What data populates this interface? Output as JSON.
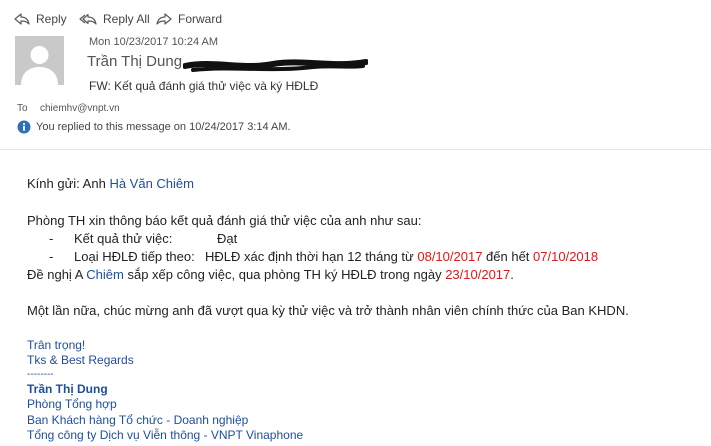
{
  "toolbar": {
    "reply_label": "Reply",
    "reply_all_label": "Reply All",
    "forward_label": "Forward"
  },
  "header": {
    "date": "Mon 10/23/2017 10:24 AM",
    "sender_name": "Trần Thị Dung",
    "subject": "FW:  Kết quả đánh giá thử việc và ký HĐLĐ",
    "to_label": "To",
    "to_value": "chiemhv@vnpt.vn",
    "info_text": "You replied to this message on 10/24/2017 3:14 AM."
  },
  "body": {
    "greeting_prefix": "Kính gửi: Anh ",
    "greeting_name": "Hà Văn Chiêm",
    "intro": "Phòng TH xin thông báo kết quả đánh giá thử việc của anh như sau:",
    "item1_dash": "-",
    "item1_label": "Kết quả thử việc:",
    "item1_value": "Đạt",
    "item2_dash": "-",
    "item2_label": "Loại HĐLĐ tiếp theo:",
    "item2_value": "HĐLĐ xác định thời hạn 12 tháng từ ",
    "item2_from": "08/10/2017",
    "item2_mid": " đến hết ",
    "item2_to": "07/10/2018",
    "request_prefix": "Đề nghị A ",
    "request_name": "Chiêm",
    "request_mid": " sắp xếp công việc, qua phòng TH ký HĐLĐ trong ngày ",
    "request_date": "23/10/2017",
    "request_end": ".",
    "congrats": "Một lần nữa, chúc mừng anh đã vượt qua kỳ thử việc và trở thành nhân viên chính thức của Ban KHDN."
  },
  "signature": {
    "line1": "Trân trọng!",
    "line2": "Tks & Best Regards",
    "divider": "--------",
    "name": "Trần Thị Dung",
    "dept": "Phòng Tổng hợp",
    "division": "Ban Khách hàng Tổ chức - Doanh nghiệp",
    "company": "Tổng công ty Dịch vụ Viễn thông - VNPT Vinaphone"
  },
  "colors": {
    "link_blue": "#1f4e9a",
    "highlight_red": "#e0161b"
  }
}
